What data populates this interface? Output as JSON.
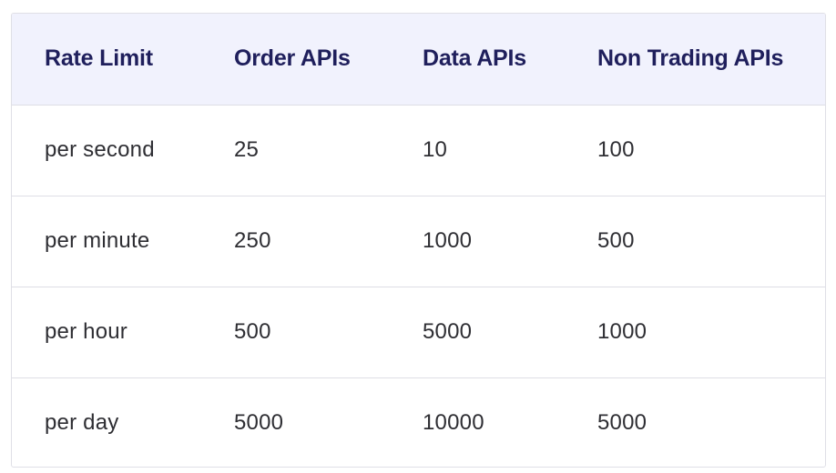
{
  "table": {
    "headers": [
      "Rate Limit",
      "Order APIs",
      "Data APIs",
      "Non Trading APIs"
    ],
    "rows": [
      [
        "per second",
        "25",
        "10",
        "100"
      ],
      [
        "per minute",
        "250",
        "1000",
        "500"
      ],
      [
        "per hour",
        "500",
        "5000",
        "1000"
      ],
      [
        "per day",
        "5000",
        "10000",
        "5000"
      ]
    ]
  },
  "colors": {
    "header_background": "#f1f2fd",
    "header_text": "#1f1f5c",
    "body_text": "#2e2e33",
    "border": "#dedee5"
  }
}
